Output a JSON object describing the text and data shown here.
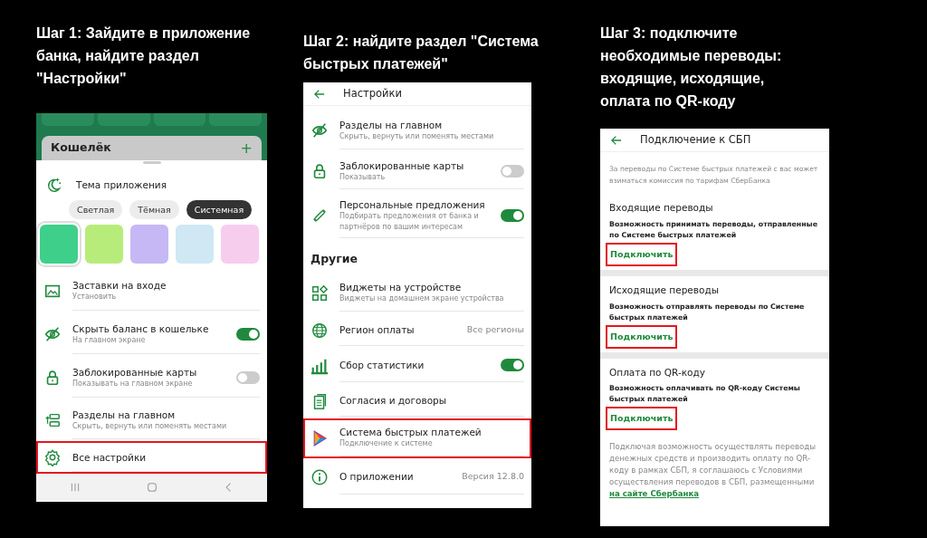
{
  "steps": [
    {
      "title": "Шаг 1: Зайдите в приложение банка, найдите раздел \"Настройки\"",
      "screen": {
        "kind": "sheet",
        "background_card": {
          "title": "Кошелёк",
          "action": "+"
        },
        "theme": {
          "title": "Тема приложения",
          "options": [
            {
              "label": "Светлая",
              "selected": false
            },
            {
              "label": "Тёмная",
              "selected": false
            },
            {
              "label": "Системная",
              "selected": true
            }
          ],
          "swatches": [
            {
              "color": "#3ed08a",
              "selected": true
            },
            {
              "color": "#b8ec7a",
              "selected": false
            },
            {
              "color": "#c5b8f5",
              "selected": false
            },
            {
              "color": "#cfe8f4",
              "selected": false
            },
            {
              "color": "#f7cdee",
              "selected": false
            }
          ]
        },
        "items": [
          {
            "kind": "plain",
            "title": "Заставки на входе",
            "subtitle": "Установить",
            "highlighted": false
          },
          {
            "kind": "toggle",
            "title": "Скрыть баланс в кошельке",
            "subtitle": "На главном экране",
            "on": true,
            "highlighted": false
          },
          {
            "kind": "toggle",
            "title": "Заблокированные карты",
            "subtitle": "Показывать на главном экране",
            "on": false,
            "highlighted": false
          },
          {
            "kind": "plain",
            "title": "Разделы на главном",
            "subtitle": "Скрыть, вернуть или поменять местами",
            "highlighted": false
          },
          {
            "kind": "plain",
            "title": "Все настройки",
            "highlighted": true
          }
        ]
      }
    },
    {
      "title": "Шаг 2: найдите раздел \"Система быстрых платежей\"",
      "screen": {
        "kind": "list",
        "header": "Настройки",
        "items": [
          {
            "kind": "plain",
            "title": "Разделы на главном",
            "subtitle": "Скрыть, вернуть или поменять местами",
            "highlighted": false
          },
          {
            "kind": "toggle",
            "title": "Заблокированные карты",
            "subtitle": "Показывать",
            "on": false,
            "highlighted": false
          },
          {
            "kind": "toggle",
            "title": "Персональные предложения",
            "subtitle": "Подбирать предложения от банка и партнёров по вашим интересам",
            "on": true,
            "highlighted": false
          },
          {
            "kind": "section",
            "title": "Другие"
          },
          {
            "kind": "plain",
            "title": "Виджеты на устройстве",
            "subtitle": "Виджеты на домашнем экране устройства",
            "highlighted": false
          },
          {
            "kind": "value",
            "title": "Регион оплаты",
            "value": "Все регионы",
            "highlighted": false
          },
          {
            "kind": "toggle",
            "title": "Сбор статистики",
            "on": true,
            "highlighted": false
          },
          {
            "kind": "plain",
            "title": "Согласия и договоры",
            "highlighted": false
          },
          {
            "kind": "plain",
            "title": "Система быстрых платежей",
            "subtitle": "Подключение к системе",
            "highlighted": true
          },
          {
            "kind": "value",
            "title": "О приложении",
            "value": "Версия 12.8.0",
            "highlighted": false
          }
        ]
      }
    },
    {
      "title": "Шаг 3: подключите необходимые переводы: входящие, исходящие, оплата по QR-коду",
      "screen": {
        "kind": "connect",
        "header": "Подключение к СБП",
        "note": "За переводы по Системе быстрых платежей с вас может взиматься комиссия по тарифам СберБанка",
        "sections": [
          {
            "title": "Входящие переводы",
            "description": "Возможность принимать переводы, отправленные по Системе быстрых платежей",
            "button": "Подключить",
            "highlighted": true
          },
          {
            "title": "Исходящие переводы",
            "description": "Возможность отправлять переводы по Системе быстрых платежей",
            "button": "Подключить",
            "highlighted": true
          },
          {
            "title": "Оплата по QR-коду",
            "description": "Возможность оплачивать по QR-коду Системы быстрых платежей",
            "button": "Подключить",
            "highlighted": true
          }
        ],
        "footer": "Подключая возможность осуществлять переводы денежных средств и производить оплату по QR-коду в рамках СБП, я соглашаюсь с Условиями осуществления переводов в СБП, размещенными",
        "footer_link": "на сайте Сбербанка"
      }
    }
  ]
}
